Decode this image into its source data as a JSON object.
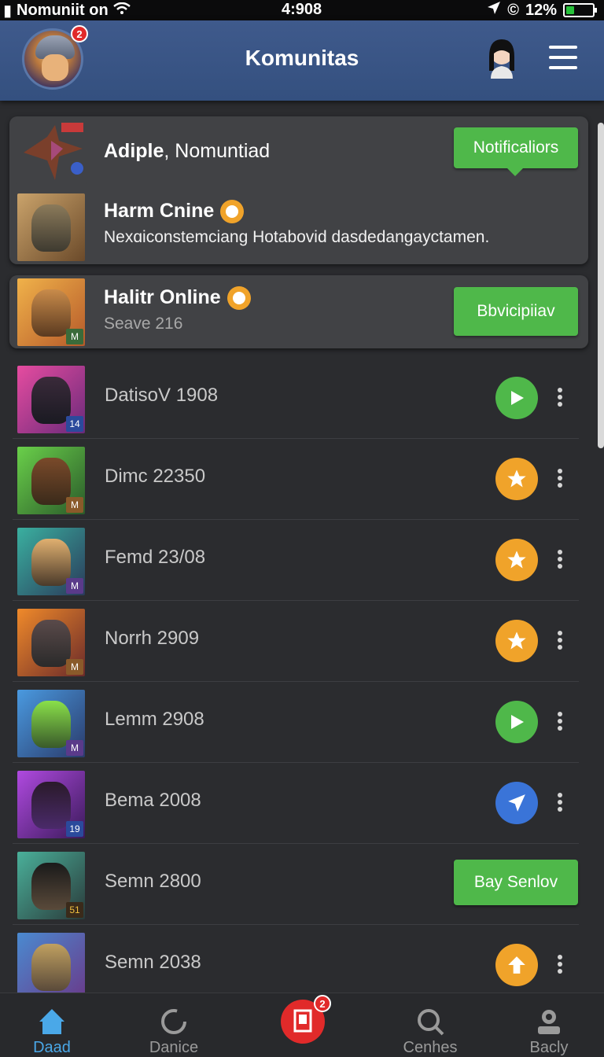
{
  "status_bar": {
    "carrier": "Nomuniit on",
    "time": "4:908",
    "battery": "12%"
  },
  "header": {
    "title": "Komunitas",
    "avatar_badge": "2"
  },
  "card1": {
    "title_bold": "Adiple",
    "title_rest": ", Nomuntiad",
    "button": "Notificaliors",
    "item_title": "Harm Cnine",
    "item_text": "Nexɑiconstemciang Hotabovid dasdedangaycta­men."
  },
  "card2": {
    "title": "Halitr Online",
    "subtitle": "Seave 216",
    "button": "Bbvicipiiav",
    "tag": "M"
  },
  "list": [
    {
      "label": "DatisoV 1908",
      "action": "play",
      "tag": "14"
    },
    {
      "label": "Dimc 22350",
      "action": "star",
      "tag": "M"
    },
    {
      "label": "Femd 23/08",
      "action": "star",
      "tag": "M"
    },
    {
      "label": "Norrh 2909",
      "action": "star",
      "tag": "M"
    },
    {
      "label": "Lemm 2908",
      "action": "play",
      "tag": "M"
    },
    {
      "label": "Bema 2008",
      "action": "send",
      "tag": "19"
    },
    {
      "label": "Semn 2800",
      "action": "button",
      "button": "Bay Senlov",
      "tag": "51"
    },
    {
      "label": "Semn 2038",
      "action": "up",
      "tag": ""
    }
  ],
  "bottom_nav": {
    "items": [
      "Daad",
      "Danice",
      "Cenhes",
      "Bacly"
    ],
    "center_badge": "2"
  },
  "colors": {
    "header": "#3f5a8c",
    "green": "#4fb84a",
    "orange": "#f0a32a",
    "blue": "#3a74d8",
    "red": "#e12a2a"
  }
}
